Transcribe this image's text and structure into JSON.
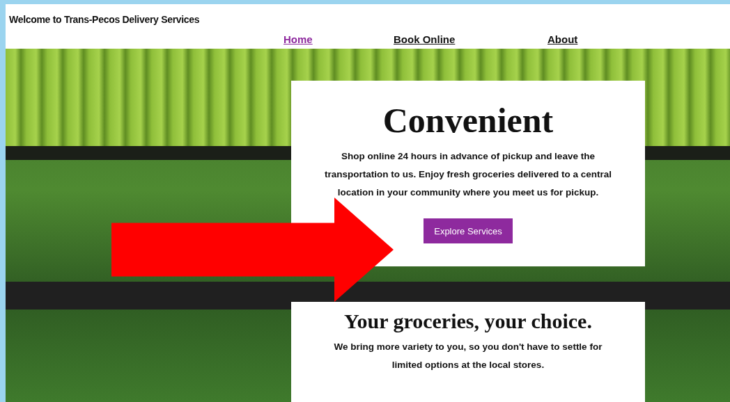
{
  "header": {
    "title": "Welcome to Trans-Pecos Delivery Services"
  },
  "nav": [
    {
      "label": "Home",
      "selected": true
    },
    {
      "label": "Book Online",
      "selected": false
    },
    {
      "label": "About",
      "selected": false
    }
  ],
  "hero": {
    "heading": "Convenient",
    "text": "Shop online 24 hours in advance of pickup and leave the transportation to us.  Enjoy fresh groceries delivered to a central location in your community where you meet us for pickup.",
    "button": "Explore Services"
  },
  "section": {
    "heading": "Your groceries, your choice.",
    "text": "We bring more variety to you, so you don't have to settle for limited options at the local stores."
  }
}
